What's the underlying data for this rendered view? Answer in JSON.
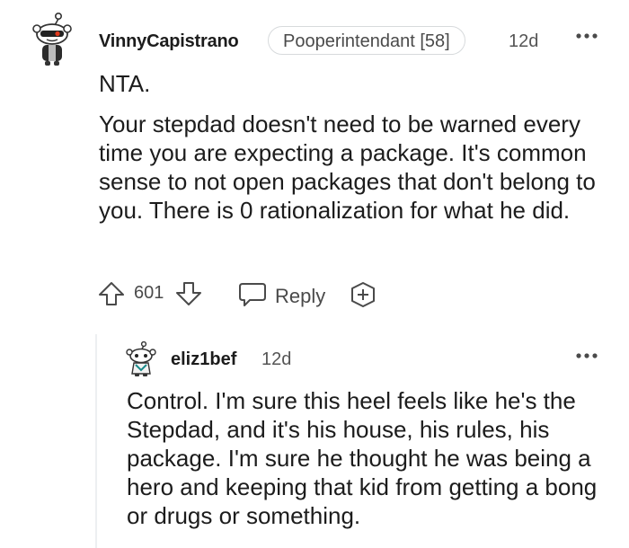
{
  "top_comment": {
    "username": "VinnyCapistrano",
    "flair": "Pooperintendant [58]",
    "age": "12d",
    "title_line": "NTA.",
    "body": "Your stepdad doesn't need to be warned every time you are expecting a package. It's common sense to not open packages that don't belong to you. There is 0 rationalization for what he did.",
    "score": "601",
    "reply_label": "Reply",
    "icons": {
      "avatar": "snoo-avatar-icon",
      "upvote": "upvote-arrow-icon",
      "downvote": "downvote-arrow-icon",
      "reply": "speech-bubble-icon",
      "award": "award-plus-icon",
      "more": "ellipsis-icon"
    }
  },
  "reply_comment": {
    "username": "eliz1bef",
    "age": "12d",
    "body": "Control. I'm sure this heel feels like he's the Stepdad, and it's his house, his rules, his package. I'm sure he thought he was being a hero and keeping that kid from getting a bong or drugs or something.",
    "icons": {
      "avatar": "snoo-avatar-icon",
      "more": "ellipsis-icon"
    }
  },
  "colors": {
    "text": "#1c1c1c",
    "meta": "#555555",
    "border": "#d7dadc",
    "thread_line": "#edeff1"
  }
}
